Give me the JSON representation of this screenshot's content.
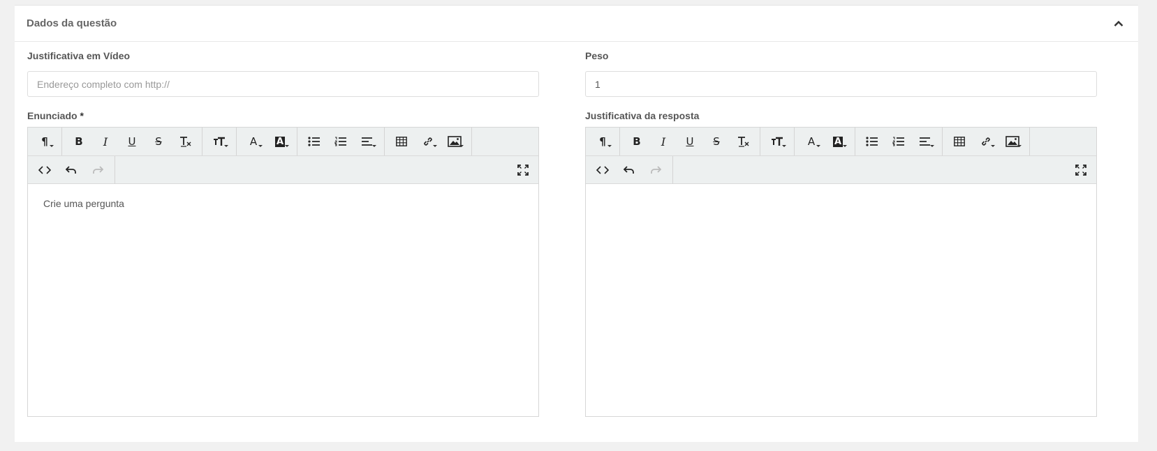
{
  "card": {
    "title": "Dados da questão"
  },
  "left": {
    "video_label": "Justificativa em Vídeo",
    "video_placeholder": "Endereço completo com http://",
    "editor_label": "Enunciado",
    "required_mark": "*",
    "editor_content": "Crie uma pergunta"
  },
  "right": {
    "weight_label": "Peso",
    "weight_value": "1",
    "editor_label": "Justificativa da resposta",
    "editor_content": ""
  },
  "toolbar": {
    "paragraph": "¶",
    "bold": "B",
    "italic": "I",
    "underline": "U",
    "strike": "S",
    "text_color": "A",
    "bg_color": "A"
  },
  "icons": [
    "chevron-up-icon",
    "paragraph-format-icon",
    "bold-icon",
    "italic-icon",
    "underline-icon",
    "strikethrough-icon",
    "clear-formatting-icon",
    "font-size-icon",
    "text-color-icon",
    "background-color-icon",
    "unordered-list-icon",
    "ordered-list-icon",
    "align-icon",
    "table-icon",
    "link-icon",
    "image-icon",
    "code-view-icon",
    "undo-icon",
    "redo-icon",
    "fullscreen-icon"
  ]
}
